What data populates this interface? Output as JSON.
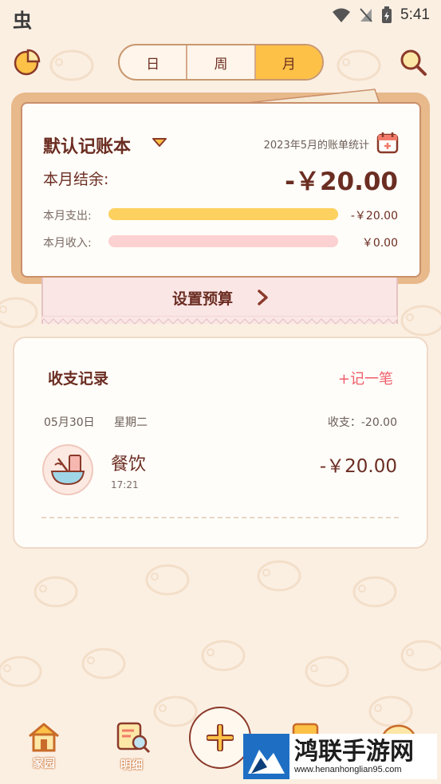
{
  "status_bar": {
    "time": "5:41",
    "app_icon": "虫"
  },
  "top_bar": {
    "tabs": [
      {
        "label": "日",
        "active": false
      },
      {
        "label": "周",
        "active": false
      },
      {
        "label": "月",
        "active": true
      }
    ],
    "left_icon": "pie-chart-icon",
    "right_icon": "search-icon"
  },
  "summary": {
    "book_title": "默认记账本",
    "stat_title": "2023年5月的账单统计",
    "balance_label": "本月结余:",
    "balance_value": "-￥20.00",
    "expense_label": "本月支出:",
    "expense_value": "-￥20.00",
    "expense_fill": 1.0,
    "income_label": "本月收入:",
    "income_value": "￥0.00",
    "income_fill": 1.0,
    "colors": {
      "expense_bar": "#fdd15f",
      "income_bar": "#fcd1d1"
    }
  },
  "budget": {
    "label": "设置预算"
  },
  "records": {
    "title": "收支记录",
    "add_label": "+记一笔",
    "groups": [
      {
        "date": "05月30日",
        "weekday": "星期二",
        "total": "收支：-20.00",
        "entries": [
          {
            "category": "餐饮",
            "time": "17:21",
            "amount": "-￥20.00",
            "icon": "food-bowl-icon"
          }
        ]
      }
    ]
  },
  "bottom_nav": {
    "items": [
      {
        "label": "家园",
        "icon": "house-icon"
      },
      {
        "label": "明细",
        "icon": "list-magnifier-icon"
      }
    ],
    "add_icon": "plus-icon"
  },
  "watermark": {
    "title": "鸿联手游网",
    "url": "www.henanhonglian95.com"
  }
}
